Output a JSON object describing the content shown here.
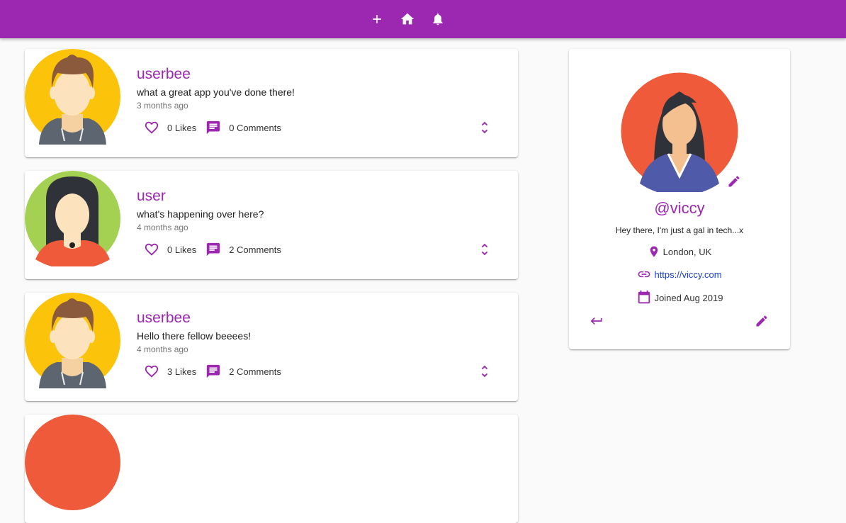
{
  "navbar": {
    "add_icon": "plus-icon",
    "home_icon": "home-icon",
    "notifications_icon": "bell-icon"
  },
  "screams": [
    {
      "user": "userbee",
      "body": "what a great app you've done there!",
      "date": "3 months ago",
      "likes": "0 Likes",
      "comments": "0 Comments",
      "avatar": "male-avatar-yellow"
    },
    {
      "user": "user",
      "body": "what's happening over here?",
      "date": "4 months ago",
      "likes": "0 Likes",
      "comments": "2 Comments",
      "avatar": "female-avatar-green"
    },
    {
      "user": "userbee",
      "body": "Hello there fellow beeees!",
      "date": "4 months ago",
      "likes": "3 Likes",
      "comments": "2 Comments",
      "avatar": "male-avatar-yellow"
    }
  ],
  "profile": {
    "handle": "@viccy",
    "bio": "Hey there, I'm just a gal in tech...x",
    "location": "London, UK",
    "website": "https://viccy.com",
    "joined": "Joined Aug 2019"
  },
  "colors": {
    "primary": "#9c27b0",
    "link": "#1a3fd6",
    "background": "#fafafa"
  }
}
